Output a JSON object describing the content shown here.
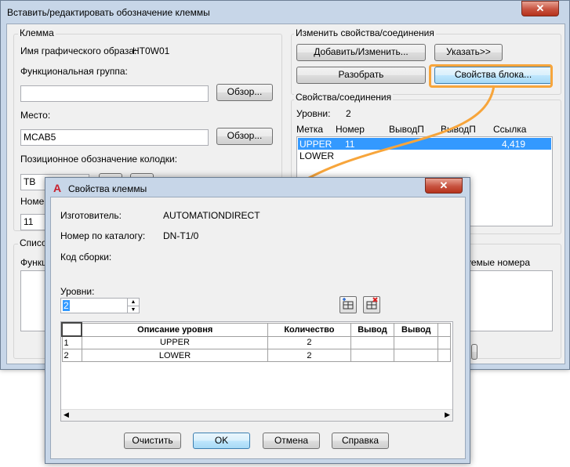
{
  "main": {
    "title": "Вставить/редактировать обозначение клеммы",
    "close_glyph": "✕",
    "terminal_group": "Клемма",
    "graphic_name_label": "Имя графического образа:",
    "graphic_name_value": "HT0W01",
    "function_group_label": "Функциональная группа:",
    "function_group_value": "",
    "browse1": "Обзор...",
    "location_label": "Место:",
    "location_value": "MCAB5",
    "browse2": "Обзор...",
    "strip_label": "Позиционное обозначение колодки:",
    "strip_value": "TB",
    "number_label": "Номер",
    "number_value": "11",
    "list_label": "Список",
    "func_label": "Функц",
    "used_numbers_label": "уемые номера",
    "change_group": "Изменить свойства/соединения",
    "add_change": "Добавить/Изменить...",
    "pick": "Указать>>",
    "disassemble": "Разобрать",
    "block_props": "Свойства блока...",
    "props_group": "Свойства/соединения",
    "levels_label": "Уровни:",
    "levels_value": "2",
    "cols": [
      "Метка",
      "Номер",
      "ВыводП",
      "ВыводП",
      "Ссылка"
    ],
    "rows": [
      {
        "label": "UPPER",
        "number": "11",
        "ref": "4,419"
      },
      {
        "label": "LOWER",
        "number": "",
        "ref": ""
      }
    ]
  },
  "dialog": {
    "title": "Свойства клеммы",
    "app_glyph": "A",
    "close_glyph": "✕",
    "manufacturer_label": "Изготовитель:",
    "manufacturer_value": "AUTOMATIONDIRECT",
    "catalog_label": "Номер по каталогу:",
    "catalog_value": "DN-T1/0",
    "assembly_label": "Код сборки:",
    "levels_label": "Уровни:",
    "levels_value": "2",
    "table_headers": [
      "",
      "Описание уровня",
      "Количество",
      "Вывод",
      "Вывод"
    ],
    "table_rows": [
      {
        "n": "1",
        "desc": "UPPER",
        "qty": "2"
      },
      {
        "n": "2",
        "desc": "LOWER",
        "qty": "2"
      }
    ],
    "clear": "Очистить",
    "ok": "OK",
    "cancel": "Отмена",
    "help": "Справка"
  },
  "colors": {
    "highlight": "#f7a53b",
    "selection": "#3399ff",
    "close_red": "#c7523f"
  }
}
